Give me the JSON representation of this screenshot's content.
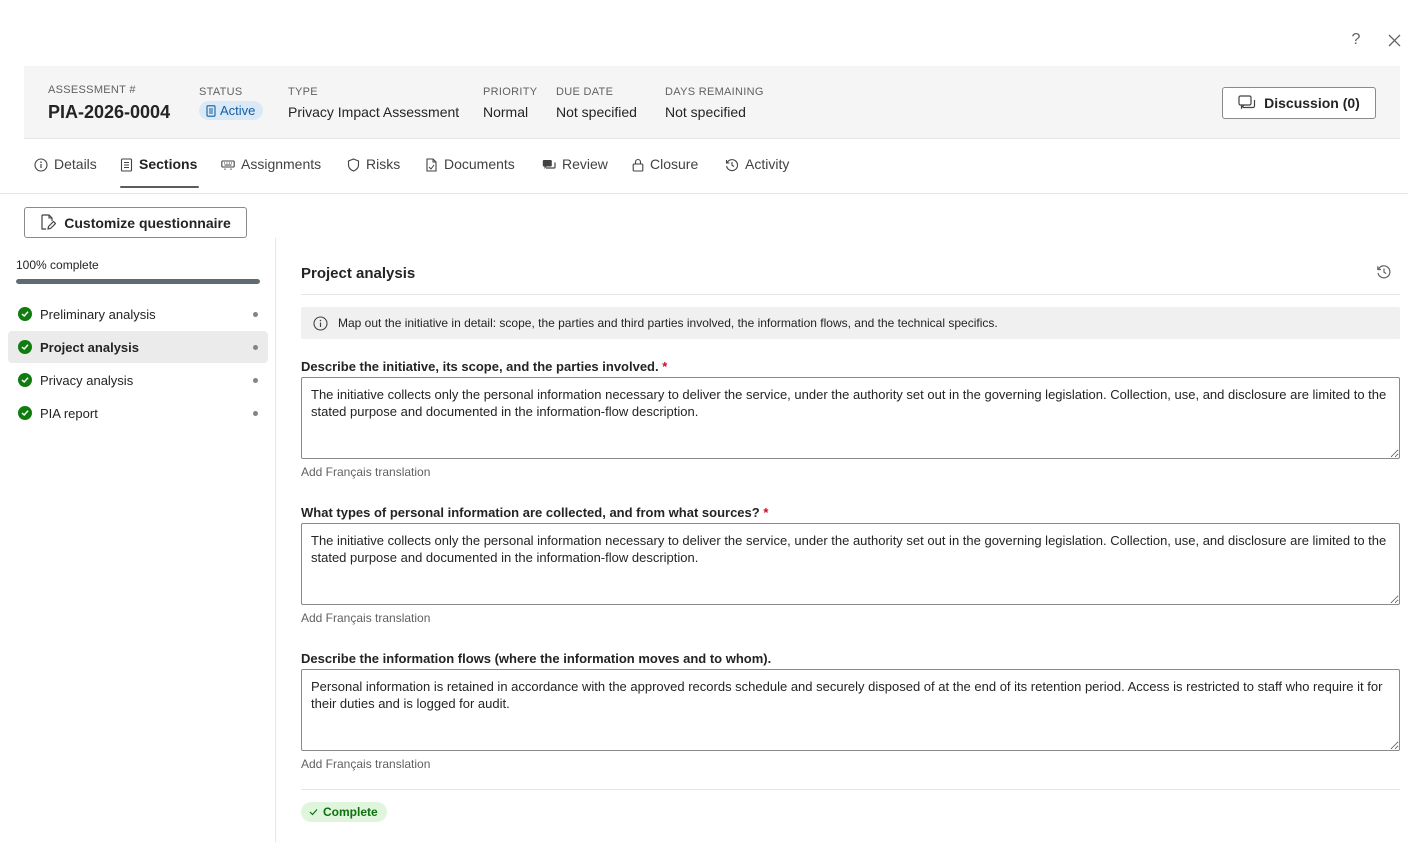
{
  "window": {
    "help_label": "?",
    "close_label": "×"
  },
  "header": {
    "assessment": {
      "label": "ASSESSMENT #",
      "value": "PIA-2026-0004"
    },
    "status": {
      "label": "STATUS",
      "value": "Active"
    },
    "type": {
      "label": "TYPE",
      "value": "Privacy Impact Assessment"
    },
    "priority": {
      "label": "PRIORITY",
      "value": "Normal"
    },
    "due_date": {
      "label": "DUE DATE",
      "value": "Not specified"
    },
    "days_remaining": {
      "label": "DAYS REMAINING",
      "value": "Not specified"
    },
    "discussion_label": "Discussion (0)"
  },
  "tabs": [
    {
      "label": "Details",
      "icon": "info-icon"
    },
    {
      "label": "Sections",
      "icon": "document-list-icon"
    },
    {
      "label": "Assignments",
      "icon": "keyboard-icon"
    },
    {
      "label": "Risks",
      "icon": "shield-icon"
    },
    {
      "label": "Documents",
      "icon": "document-icon"
    },
    {
      "label": "Review",
      "icon": "chat-icon"
    },
    {
      "label": "Closure",
      "icon": "lock-icon"
    },
    {
      "label": "Activity",
      "icon": "history-icon"
    }
  ],
  "toolbar": {
    "customize_label": "Customize questionnaire"
  },
  "sidebar": {
    "progress_label": "100% complete",
    "progress": 1.0,
    "items": [
      {
        "label": "Preliminary analysis"
      },
      {
        "label": "Project analysis"
      },
      {
        "label": "Privacy analysis"
      },
      {
        "label": "PIA report"
      }
    ]
  },
  "section": {
    "title": "Project analysis",
    "info": "Map out the initiative in detail: scope, the parties and third parties involved, the information flows, and the technical specifics.",
    "questions": [
      {
        "label": "Describe the initiative, its scope, and the parties involved.",
        "required": "*",
        "answer": "The initiative collects only the personal information necessary to deliver the service, under the authority set out in the governing legislation. Collection, use, and disclosure are limited to the stated purpose and documented in the information-flow description.",
        "translation_link": "Add Français translation"
      },
      {
        "label": "What types of personal information are collected, and from what sources?",
        "required": "*",
        "answer": "The initiative collects only the personal information necessary to deliver the service, under the authority set out in the governing legislation. Collection, use, and disclosure are limited to the stated purpose and documented in the information-flow description.",
        "translation_link": "Add Français translation"
      },
      {
        "label": "Describe the information flows (where the information moves and to whom).",
        "required": "",
        "answer": "Personal information is retained in accordance with the approved records schedule and securely disposed of at the end of its retention period. Access is restricted to staff who require it for their duties and is logged for audit.",
        "translation_link": "Add Français translation"
      }
    ],
    "complete_label": "Complete"
  },
  "colors": {
    "accent_green": "#107c10",
    "status_blue": "#115ea3",
    "required_red": "#c50f1f"
  }
}
